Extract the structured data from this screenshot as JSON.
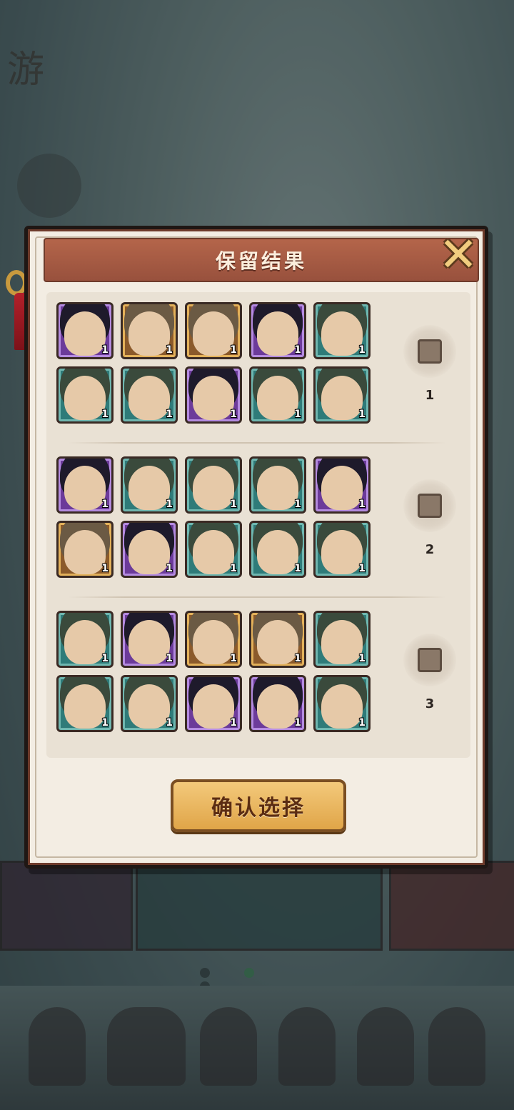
{
  "dialog": {
    "title": "保留结果",
    "close_icon": "close-x-icon",
    "confirm_label": "确认选择"
  },
  "groups": [
    {
      "option_number": "1",
      "rows": [
        [
          {
            "rarity": "purple",
            "hero": "green-dragon-warrior",
            "qty": "1"
          },
          {
            "rarity": "gold",
            "hero": "silver-haired-swordsman",
            "qty": "1"
          },
          {
            "rarity": "gold",
            "hero": "green-haired-maiden",
            "qty": "1"
          },
          {
            "rarity": "purple",
            "hero": "deer-spirit",
            "qty": "1"
          },
          {
            "rarity": "green",
            "hero": "dark-haired-strategist",
            "qty": "1"
          }
        ],
        [
          {
            "rarity": "green",
            "hero": "dark-haired-scholar",
            "qty": "1"
          },
          {
            "rarity": "green",
            "hero": "orange-haired-girl",
            "qty": "1"
          },
          {
            "rarity": "purple",
            "hero": "black-haired-girl",
            "qty": "1"
          },
          {
            "rarity": "green",
            "hero": "white-haired-fox-girl",
            "qty": "1"
          },
          {
            "rarity": "green",
            "hero": "red-bearded-general",
            "qty": "1"
          }
        ]
      ]
    },
    {
      "option_number": "2",
      "rows": [
        [
          {
            "rarity": "purple",
            "hero": "green-dragon-warrior",
            "qty": "1"
          },
          {
            "rarity": "green",
            "hero": "white-haired-fox-girl",
            "qty": "1"
          },
          {
            "rarity": "green",
            "hero": "blonde-swordsman",
            "qty": "1"
          },
          {
            "rarity": "green",
            "hero": "dark-haired-youth",
            "qty": "1"
          },
          {
            "rarity": "purple",
            "hero": "black-haired-girl",
            "qty": "1"
          }
        ],
        [
          {
            "rarity": "gold",
            "hero": "silver-haired-lady",
            "qty": "1"
          },
          {
            "rarity": "purple",
            "hero": "blonde-sage",
            "qty": "1"
          },
          {
            "rarity": "green",
            "hero": "white-haired-fox-girl",
            "qty": "1"
          },
          {
            "rarity": "green",
            "hero": "white-tiger-girl",
            "qty": "1"
          },
          {
            "rarity": "green",
            "hero": "blonde-swordsman",
            "qty": "1"
          }
        ]
      ]
    },
    {
      "option_number": "3",
      "rows": [
        [
          {
            "rarity": "green",
            "hero": "brown-haired-archer",
            "qty": "1"
          },
          {
            "rarity": "purple",
            "hero": "dark-skinned-dancer",
            "qty": "1"
          },
          {
            "rarity": "gold",
            "hero": "golden-helmet-warrior",
            "qty": "1"
          },
          {
            "rarity": "gold",
            "hero": "flute-maiden",
            "qty": "1"
          },
          {
            "rarity": "green",
            "hero": "red-bearded-general",
            "qty": "1"
          }
        ],
        [
          {
            "rarity": "green",
            "hero": "orange-haired-girl",
            "qty": "1"
          },
          {
            "rarity": "green",
            "hero": "dark-haired-youth",
            "qty": "1"
          },
          {
            "rarity": "purple",
            "hero": "hooded-swordsman",
            "qty": "1"
          },
          {
            "rarity": "purple",
            "hero": "dark-skinned-dancer",
            "qty": "1"
          },
          {
            "rarity": "green",
            "hero": "red-bearded-general",
            "qty": "1"
          }
        ]
      ]
    }
  ]
}
